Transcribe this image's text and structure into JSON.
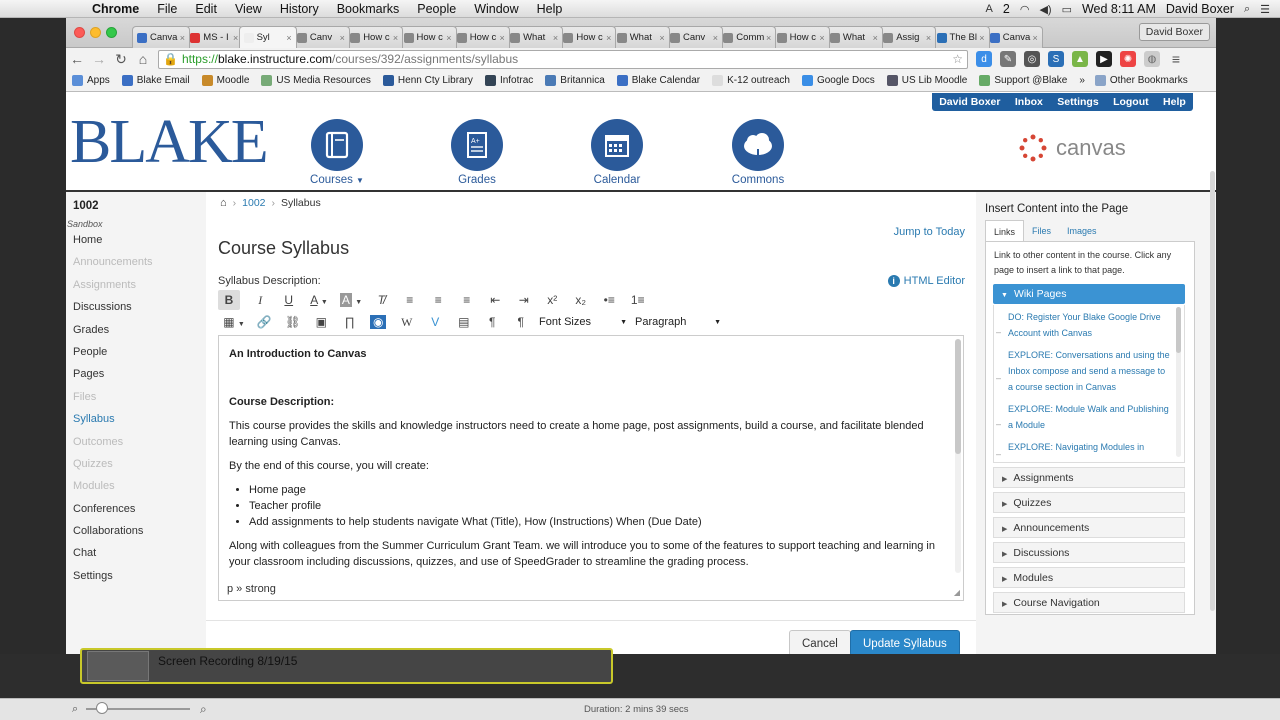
{
  "os_menu": {
    "app": "Chrome",
    "items": [
      "File",
      "Edit",
      "View",
      "History",
      "Bookmarks",
      "People",
      "Window",
      "Help"
    ],
    "clock": "Wed 8:11 AM",
    "user": "David Boxer",
    "notif_count": "2"
  },
  "tabs": [
    "Canva",
    "MS - I",
    "Syl",
    "Canv",
    "How c",
    "How c",
    "How c",
    "What",
    "How c",
    "What",
    "Canv",
    "Comm",
    "How c",
    "What",
    "Assig",
    "The Bl",
    "Canva"
  ],
  "profile_button": "David Boxer",
  "address": {
    "https": "https://",
    "host": "blake.instructure.com",
    "path": "/courses/392/assignments/syllabus"
  },
  "bookmarks": [
    "Apps",
    "Blake Email",
    "Moodle",
    "US Media Resources",
    "Henn Cty Library",
    "Infotrac",
    "Britannica",
    "Blake Calendar",
    "K-12 outreach",
    "Google Docs",
    "US Lib Moodle",
    "Support @Blake",
    "Other Bookmarks"
  ],
  "bookmarks_overflow": "»",
  "usernav": [
    "David Boxer",
    "Inbox",
    "Settings",
    "Logout",
    "Help"
  ],
  "logo": "BLAKE",
  "global_nav": {
    "courses": "Courses",
    "grades": "Grades",
    "calendar": "Calendar",
    "commons": "Commons"
  },
  "brand": "canvas",
  "course": {
    "code": "1002",
    "section": "Sandbox"
  },
  "left_nav": [
    {
      "label": "Home",
      "state": "normal"
    },
    {
      "label": "Announcements",
      "state": "disabled"
    },
    {
      "label": "Assignments",
      "state": "disabled"
    },
    {
      "label": "Discussions",
      "state": "normal"
    },
    {
      "label": "Grades",
      "state": "normal"
    },
    {
      "label": "People",
      "state": "normal"
    },
    {
      "label": "Pages",
      "state": "normal"
    },
    {
      "label": "Files",
      "state": "disabled"
    },
    {
      "label": "Syllabus",
      "state": "selected"
    },
    {
      "label": "Outcomes",
      "state": "disabled"
    },
    {
      "label": "Quizzes",
      "state": "disabled"
    },
    {
      "label": "Modules",
      "state": "disabled"
    },
    {
      "label": "Conferences",
      "state": "normal"
    },
    {
      "label": "Collaborations",
      "state": "normal"
    },
    {
      "label": "Chat",
      "state": "normal"
    },
    {
      "label": "Settings",
      "state": "normal"
    }
  ],
  "breadcrumb": {
    "course": "1002",
    "current": "Syllabus"
  },
  "jump_today": "Jump to Today",
  "page_title": "Course Syllabus",
  "syllabus_desc_label": "Syllabus Description:",
  "html_editor": "HTML Editor",
  "toolbar": {
    "font_sizes": "Font Sizes",
    "paragraph": "Paragraph"
  },
  "content": {
    "heading": "An Introduction to Canvas",
    "subheading": "Course Description:",
    "para1": "This course provides the skills and knowledge instructors need to create a home page, post assignments, build a course, and facilitate blended learning using Canvas.",
    "para2": "By the end of this course, you will create:",
    "bullets": [
      "Home page",
      "Teacher profile",
      "Add assignments to help students navigate What (Title), How (Instructions) When (Due Date)"
    ],
    "para3": "Along with colleagues from the Summer Curriculum Grant Team. we will introduce you to some of the features to support teaching and learning in your classroom including discussions, quizzes, and use of SpeedGrader to streamline the grading process."
  },
  "status_path": "p » strong",
  "buttons": {
    "cancel": "Cancel",
    "update": "Update Syllabus"
  },
  "sidebar": {
    "title": "Insert Content into the Page",
    "tabs": [
      "Links",
      "Files",
      "Images"
    ],
    "help": "Link to other content in the course. Click any page to insert a link to that page.",
    "wiki_header": "Wiki Pages",
    "wiki_items": [
      "DO: Register Your Blake Google Drive Account with Canvas",
      "EXPLORE: Conversations and using the Inbox compose and send a message to a course section in Canvas",
      "EXPLORE: Module Walk and Publishing a Module",
      "EXPLORE: Navigating Modules in"
    ],
    "sections": [
      "Assignments",
      "Quizzes",
      "Announcements",
      "Discussions",
      "Modules",
      "Course Navigation"
    ]
  },
  "recording": {
    "title": "Screen Recording 8/19/15",
    "duration": "Duration: 2 mins 39 secs"
  },
  "colors": {
    "accent": "#2a7ab0",
    "brand_blue": "#2b5a9a",
    "usernav": "#1f5e9f",
    "button_primary": "#2a87c9"
  }
}
